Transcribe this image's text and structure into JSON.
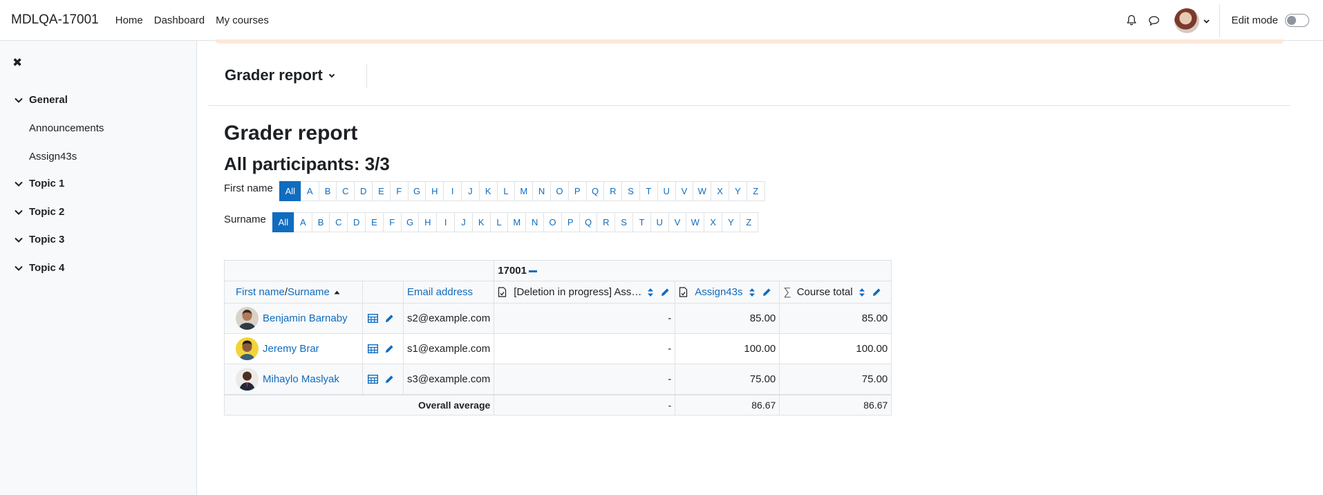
{
  "navbar": {
    "brand": "MDLQA-17001",
    "links": [
      "Home",
      "Dashboard",
      "My courses"
    ],
    "edit_mode_label": "Edit mode",
    "icons": [
      "bell-icon",
      "chat-icon",
      "user-avatar",
      "chevron-down-icon"
    ]
  },
  "sidebar": {
    "close": "✖",
    "sections": [
      {
        "label": "General",
        "items": [
          "Announcements",
          "Assign43s"
        ]
      },
      {
        "label": "Topic 1",
        "items": []
      },
      {
        "label": "Topic 2",
        "items": []
      },
      {
        "label": "Topic 3",
        "items": []
      },
      {
        "label": "Topic 4",
        "items": []
      }
    ]
  },
  "report": {
    "selector_label": "Grader report",
    "title": "Grader report",
    "participants": "All participants: 3/3"
  },
  "filters": {
    "first_name_label": "First name",
    "surname_label": "Surname",
    "letters": [
      "All",
      "A",
      "B",
      "C",
      "D",
      "E",
      "F",
      "G",
      "H",
      "I",
      "J",
      "K",
      "L",
      "M",
      "N",
      "O",
      "P",
      "Q",
      "R",
      "S",
      "T",
      "U",
      "V",
      "W",
      "X",
      "Y",
      "Z"
    ]
  },
  "table": {
    "category": "17001",
    "headers": {
      "first_name": "First name",
      "separator": " / ",
      "surname": "Surname",
      "email": "Email address",
      "item1": "[Deletion in progress] Ass…",
      "item2": "Assign43s",
      "total": "Course total"
    },
    "rows": [
      {
        "name": "Benjamin Barnaby",
        "email": "s2@example.com",
        "item1": "-",
        "item2": "85.00",
        "total": "85.00"
      },
      {
        "name": "Jeremy Brar",
        "email": "s1@example.com",
        "item1": "-",
        "item2": "100.00",
        "total": "100.00"
      },
      {
        "name": "Mihaylo Maslyak",
        "email": "s3@example.com",
        "item1": "-",
        "item2": "75.00",
        "total": "75.00"
      }
    ],
    "average": {
      "label": "Overall average",
      "item1": "-",
      "item2": "86.67",
      "total": "86.67"
    }
  },
  "colors": {
    "link": "#0f6cbf",
    "active_letter_bg": "#0f6cbf",
    "sidebar_bg": "#f8f9fa"
  }
}
